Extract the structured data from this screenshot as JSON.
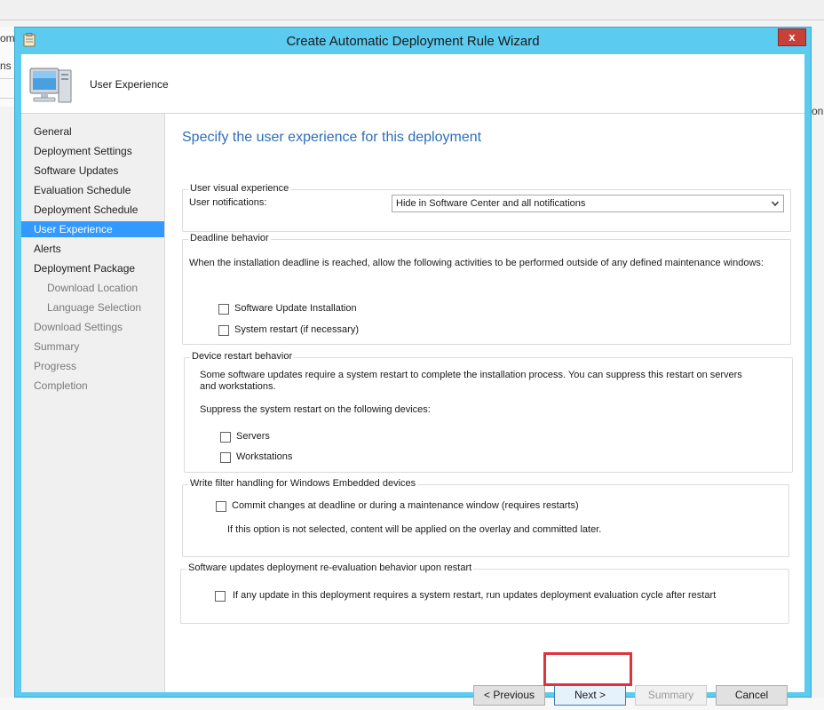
{
  "window": {
    "title": "Create Automatic Deployment Rule Wizard",
    "close_label": "x"
  },
  "background": {
    "frag1": "om",
    "frag2": "ns",
    "frag3": "on"
  },
  "header": {
    "title": "User Experience"
  },
  "nav": {
    "items": [
      {
        "label": "General"
      },
      {
        "label": "Deployment Settings"
      },
      {
        "label": "Software Updates"
      },
      {
        "label": "Evaluation Schedule"
      },
      {
        "label": "Deployment Schedule"
      },
      {
        "label": "User Experience"
      },
      {
        "label": "Alerts"
      },
      {
        "label": "Deployment Package"
      },
      {
        "label": "Download Location"
      },
      {
        "label": "Language Selection"
      },
      {
        "label": "Download Settings"
      },
      {
        "label": "Summary"
      },
      {
        "label": "Progress"
      },
      {
        "label": "Completion"
      }
    ]
  },
  "page": {
    "heading": "Specify the user experience for this deployment"
  },
  "visual": {
    "legend": "User visual experience",
    "notifications_label": "User notifications:",
    "notifications_value": "Hide in Software Center and all notifications"
  },
  "deadline": {
    "legend": "Deadline behavior",
    "description": "When the installation deadline is reached, allow the following activities to be performed outside of any defined maintenance windows:",
    "opt1": "Software Update Installation",
    "opt2": "System restart (if necessary)"
  },
  "restart": {
    "legend": "Device restart behavior",
    "description": "Some software updates require a system restart to complete the installation process. You can suppress this restart on servers and workstations.",
    "suppress_label": "Suppress the system restart on the following devices:",
    "opt1": "Servers",
    "opt2": "Workstations"
  },
  "writefilter": {
    "legend": "Write filter handling for Windows Embedded devices",
    "opt1": "Commit changes at deadline or during a maintenance window (requires restarts)",
    "note": "If this option is not selected, content will be applied on the overlay and committed later."
  },
  "reeval": {
    "legend": "Software updates deployment re-evaluation behavior upon restart",
    "opt1": "If any update in this deployment requires a system restart, run updates deployment evaluation cycle after restart"
  },
  "buttons": {
    "previous": "< Previous",
    "next": "Next >",
    "summary": "Summary",
    "cancel": "Cancel"
  },
  "colors": {
    "window_border": "#5bcbf0",
    "nav_selected": "#3399ff",
    "heading": "#2d6fb9",
    "close": "#c7413a",
    "highlight": "#e0323c"
  }
}
